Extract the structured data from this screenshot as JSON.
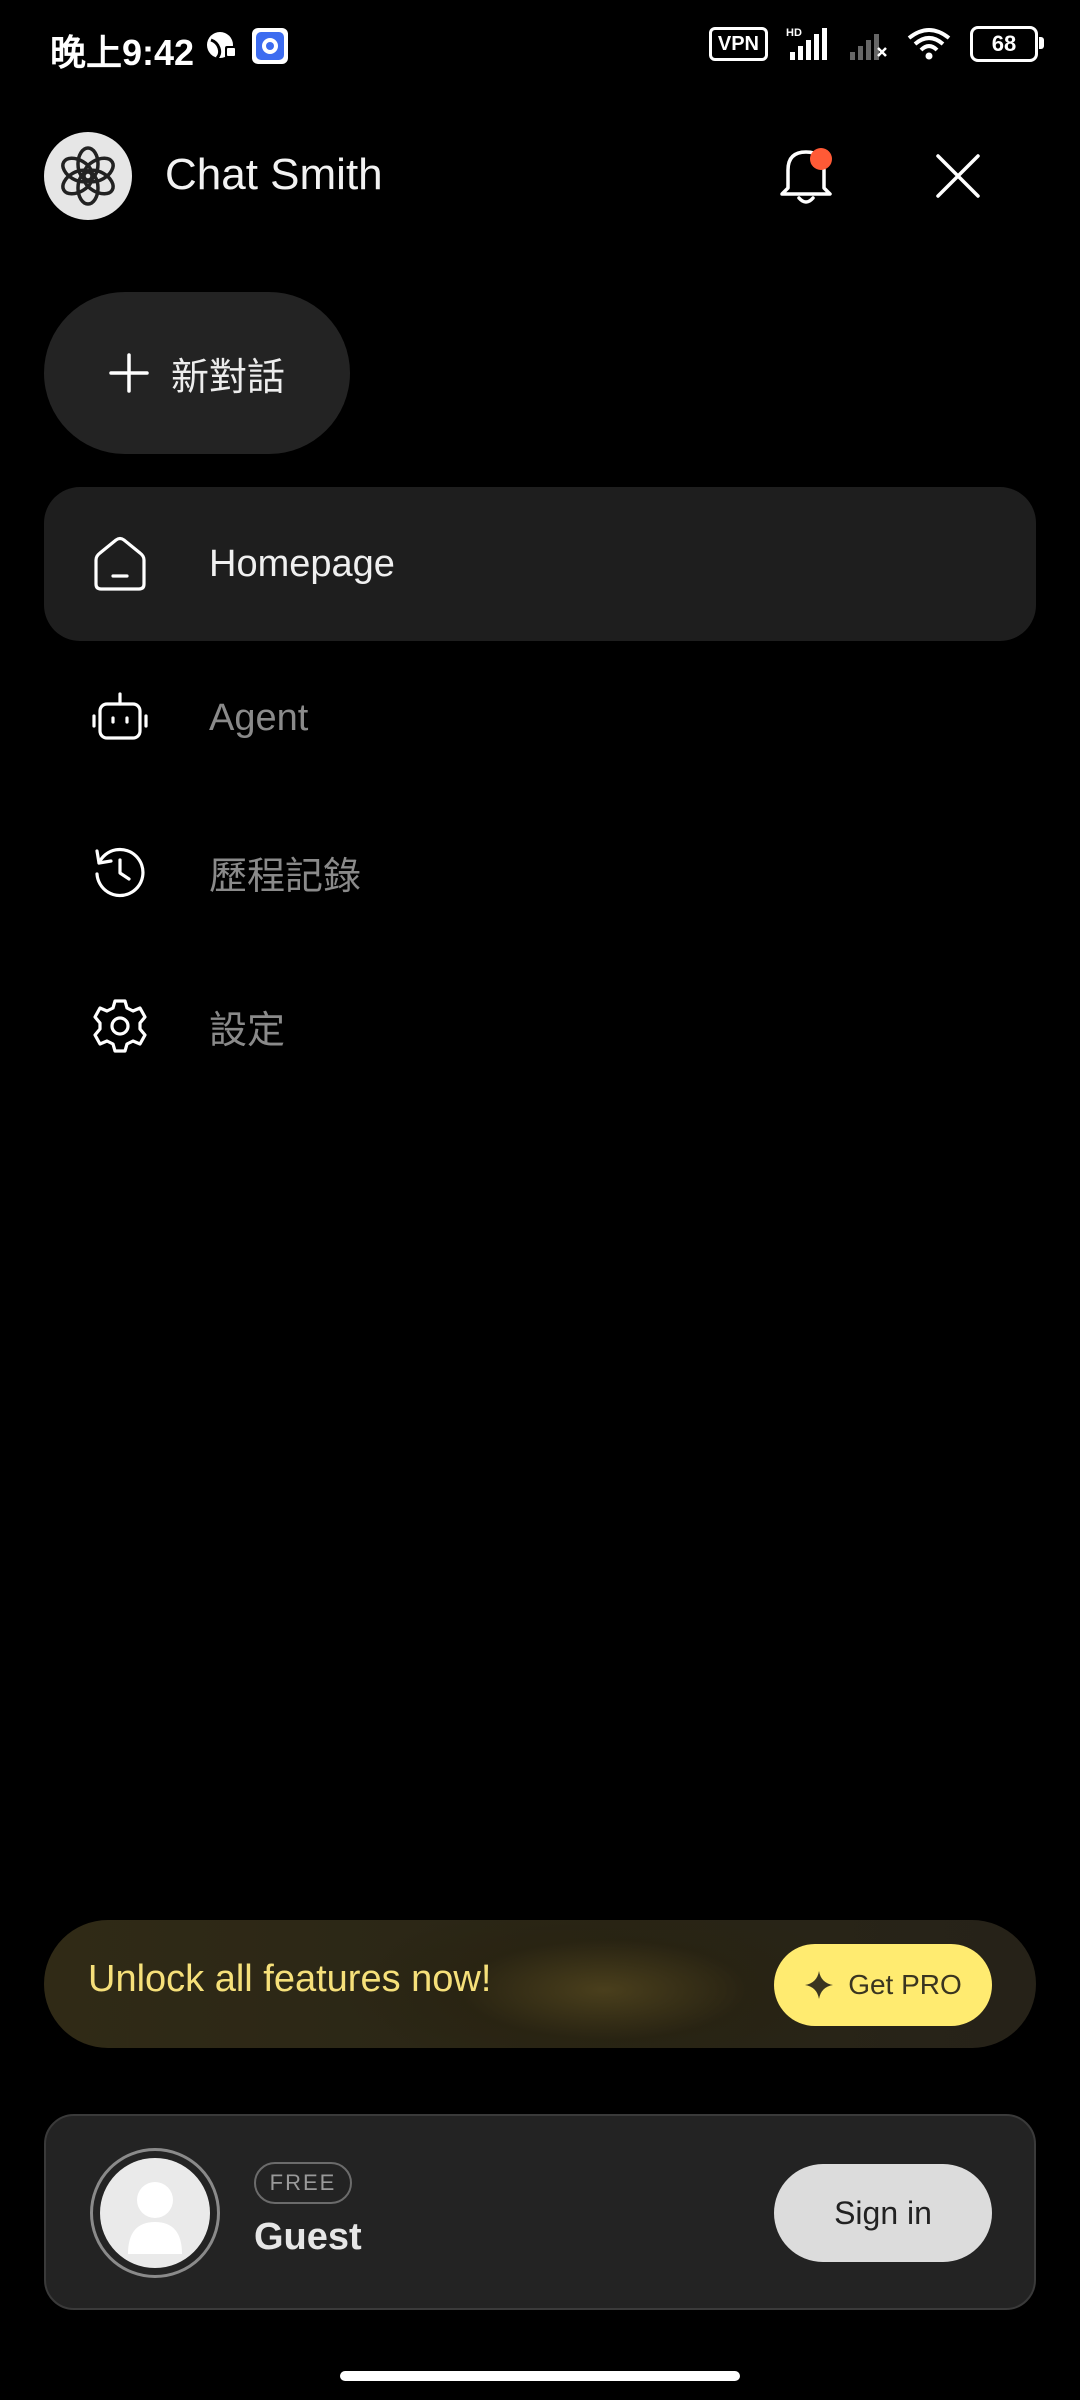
{
  "status_bar": {
    "time": "晚上9:42",
    "vpn": "VPN",
    "battery": "68"
  },
  "header": {
    "app_name": "Chat Smith"
  },
  "new_chat": {
    "label": "新對話"
  },
  "menu": {
    "items": [
      {
        "label": "Homepage",
        "icon": "home-icon",
        "active": true
      },
      {
        "label": "Agent",
        "icon": "robot-icon",
        "active": false
      },
      {
        "label": "歷程記錄",
        "icon": "history-icon",
        "active": false
      },
      {
        "label": "設定",
        "icon": "gear-icon",
        "active": false
      }
    ]
  },
  "promo": {
    "text": "Unlock all features now!",
    "button": "Get PRO"
  },
  "account": {
    "badge": "FREE",
    "name": "Guest",
    "sign_in": "Sign in"
  },
  "colors": {
    "background": "#000000",
    "accent_yellow": "#ffeb70",
    "notification_dot": "#ff5a36"
  }
}
